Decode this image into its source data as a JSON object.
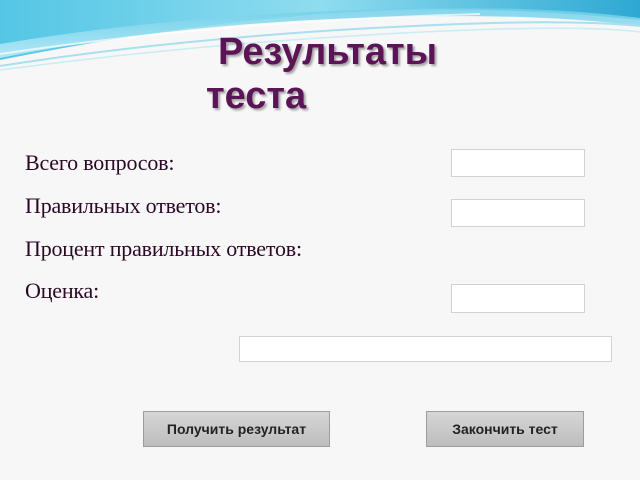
{
  "title": {
    "line1": "Результаты",
    "line2": "теста"
  },
  "labels": {
    "total_questions": "Всего вопросов:",
    "correct_answers": "Правильных ответов:",
    "percent_correct": "Процент правильных ответов:",
    "grade": "Оценка:"
  },
  "fields": {
    "total_questions_value": "",
    "correct_answers_value": "",
    "grade_value": "",
    "message_value": ""
  },
  "buttons": {
    "get_result": "Получить результат",
    "finish_test": "Закончить тест"
  },
  "colors": {
    "title": "#5b1455",
    "label_text": "#2a0826",
    "wave_blue": "#3fb6d9",
    "button_gray": "#c8c8c8"
  }
}
